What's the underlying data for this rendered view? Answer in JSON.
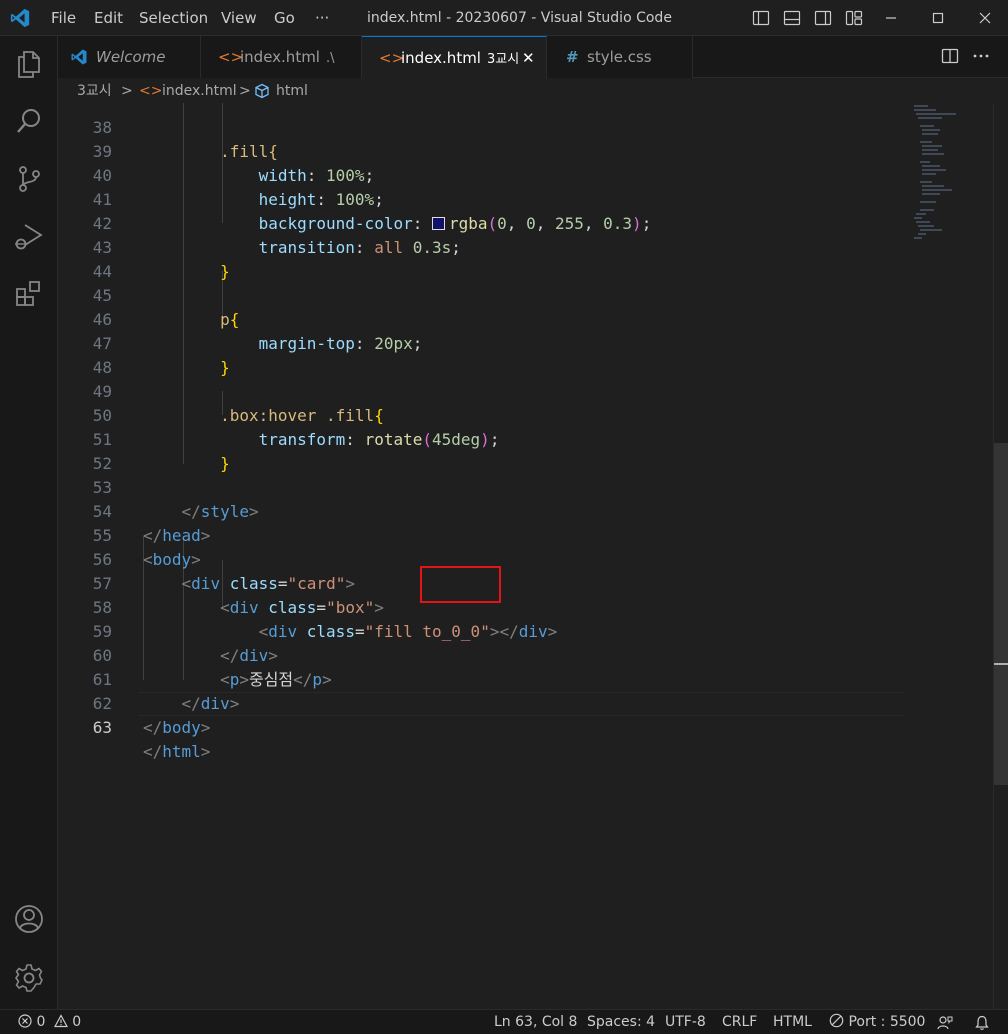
{
  "titlebar": {
    "menus": [
      "File",
      "Edit",
      "Selection",
      "View",
      "Go",
      "···"
    ],
    "title": "index.html - 20230607 - Visual Studio Code"
  },
  "tabs": [
    {
      "label": "Welcome",
      "icon": "vscode-logo-icon",
      "active": false
    },
    {
      "label": "index.html",
      "sub": ".\\",
      "icon": "html-icon",
      "active": false
    },
    {
      "label": "index.html",
      "sub": "3교시",
      "icon": "html-icon",
      "active": true,
      "close": "✕"
    },
    {
      "label": "style.css",
      "icon": "css-hash-icon",
      "active": false
    }
  ],
  "breadcrumb": {
    "folder": "3교시",
    "file": "index.html",
    "symbol": "html",
    "separator": ">"
  },
  "editor": {
    "line_numbers": [
      "38",
      "39",
      "40",
      "41",
      "42",
      "43",
      "44",
      "45",
      "46",
      "47",
      "48",
      "49",
      "50",
      "51",
      "52",
      "53",
      "54",
      "55",
      "56",
      "57",
      "58",
      "59",
      "60",
      "61",
      "62",
      "63"
    ],
    "current_line": "63",
    "code": {
      "l38": ".fill{",
      "l39_prop": "width",
      "l39_val": "100%",
      "l40_prop": "height",
      "l40_val": "100%",
      "l41_prop": "background-color",
      "l41_fn": "rgba",
      "l41_args": [
        "0",
        "0",
        "255",
        "0.3"
      ],
      "l42_prop": "transition",
      "l42_kw": "all",
      "l42_val": "0.3s",
      "l45_sel": "p",
      "l46_prop": "margin-top",
      "l46_val": "20px",
      "l49_sel": ".box:hover .fill",
      "l50_prop": "transform",
      "l50_fn": "rotate",
      "l50_arg": "45deg",
      "l53_tag": "style",
      "l54_tag": "head",
      "l55_tag": "body",
      "l56_tag": "div",
      "l56_attr": "class",
      "l56_val": "\"card\"",
      "l57_tag": "div",
      "l57_attr": "class",
      "l57_val": "\"box\"",
      "l58_tag": "div",
      "l58_attr": "class",
      "l58_val_a": "\"fill ",
      "l58_val_b": "to_0_0\"",
      "l59_tag": "div",
      "l60_tag": "p",
      "l60_text": "중심점",
      "l61_tag": "div",
      "l62_tag": "body",
      "l63_tag": "html"
    }
  },
  "statusbar": {
    "errors": "0",
    "warnings": "0",
    "position": "Ln 63, Col 8",
    "spaces": "Spaces: 4",
    "encoding": "UTF-8",
    "eol": "CRLF",
    "language": "HTML",
    "port": "Port : 5500"
  },
  "colors": {
    "accent": "#0078d4",
    "highlight_box": "#e51414",
    "swatch": "#12126a"
  }
}
